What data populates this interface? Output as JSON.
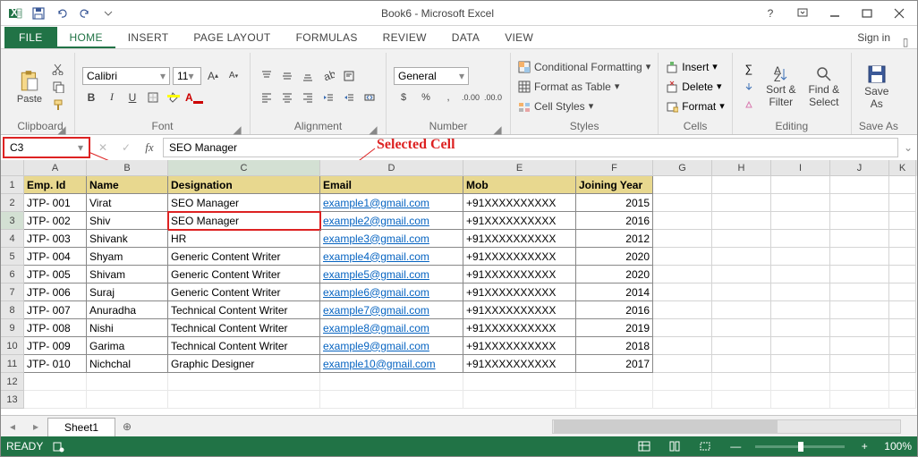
{
  "title": "Book6 - Microsoft Excel",
  "signin": "Sign in",
  "tabs": {
    "file": "FILE",
    "home": "HOME",
    "insert": "INSERT",
    "page": "PAGE LAYOUT",
    "formulas": "FORMULAS",
    "review": "REVIEW",
    "data": "DATA",
    "view": "VIEW"
  },
  "ribbon": {
    "clipboard": {
      "paste": "Paste",
      "label": "Clipboard"
    },
    "font": {
      "name": "Calibri",
      "size": "11",
      "label": "Font"
    },
    "alignment": {
      "label": "Alignment"
    },
    "number": {
      "format": "General",
      "label": "Number"
    },
    "styles": {
      "cond": "Conditional Formatting",
      "table": "Format as Table",
      "cell": "Cell Styles",
      "label": "Styles"
    },
    "cells": {
      "insert": "Insert",
      "delete": "Delete",
      "format": "Format",
      "label": "Cells"
    },
    "editing": {
      "sort": "Sort &",
      "filter": "Filter",
      "find": "Find &",
      "select": "Select",
      "label": "Editing"
    },
    "save": {
      "save": "Save",
      "as": "As",
      "label": "Save As"
    }
  },
  "namebox": "C3",
  "formula": "SEO Manager",
  "annotation": "Selected Cell",
  "cols": [
    "A",
    "B",
    "C",
    "D",
    "E",
    "F",
    "G",
    "H",
    "I",
    "J",
    "K"
  ],
  "headers": [
    "Emp. Id",
    "Name",
    "Designation",
    "Email",
    "Mob",
    "Joining Year"
  ],
  "rows": [
    {
      "id": "JTP- 001",
      "name": "Virat",
      "desig": "SEO Manager",
      "email": "example1@gmail.com",
      "mob": "+91XXXXXXXXXX",
      "year": "2015"
    },
    {
      "id": "JTP- 002",
      "name": "Shiv",
      "desig": "SEO Manager",
      "email": "example2@gmail.com",
      "mob": "+91XXXXXXXXXX",
      "year": "2016"
    },
    {
      "id": "JTP- 003",
      "name": "Shivank",
      "desig": "HR",
      "email": "example3@gmail.com",
      "mob": "+91XXXXXXXXXX",
      "year": "2012"
    },
    {
      "id": "JTP- 004",
      "name": "Shyam",
      "desig": "Generic Content Writer",
      "email": "example4@gmail.com",
      "mob": "+91XXXXXXXXXX",
      "year": "2020"
    },
    {
      "id": "JTP- 005",
      "name": "Shivam",
      "desig": "Generic Content Writer",
      "email": "example5@gmail.com",
      "mob": "+91XXXXXXXXXX",
      "year": "2020"
    },
    {
      "id": "JTP- 006",
      "name": "Suraj",
      "desig": "Generic Content Writer",
      "email": "example6@gmail.com",
      "mob": "+91XXXXXXXXXX",
      "year": "2014"
    },
    {
      "id": "JTP- 007",
      "name": "Anuradha",
      "desig": "Technical Content Writer",
      "email": "example7@gmail.com",
      "mob": "+91XXXXXXXXXX",
      "year": "2016"
    },
    {
      "id": "JTP- 008",
      "name": "Nishi",
      "desig": "Technical Content Writer",
      "email": "example8@gmail.com",
      "mob": "+91XXXXXXXXXX",
      "year": "2019"
    },
    {
      "id": "JTP- 009",
      "name": "Garima",
      "desig": "Technical Content Writer",
      "email": "example9@gmail.com",
      "mob": "+91XXXXXXXXXX",
      "year": "2018"
    },
    {
      "id": "JTP- 010",
      "name": "Nichchal",
      "desig": "Graphic Designer",
      "email": "example10@gmail.com",
      "mob": "+91XXXXXXXXXX",
      "year": "2017"
    }
  ],
  "sheet": {
    "name": "Sheet1"
  },
  "status": {
    "ready": "READY",
    "zoom": "100%"
  }
}
